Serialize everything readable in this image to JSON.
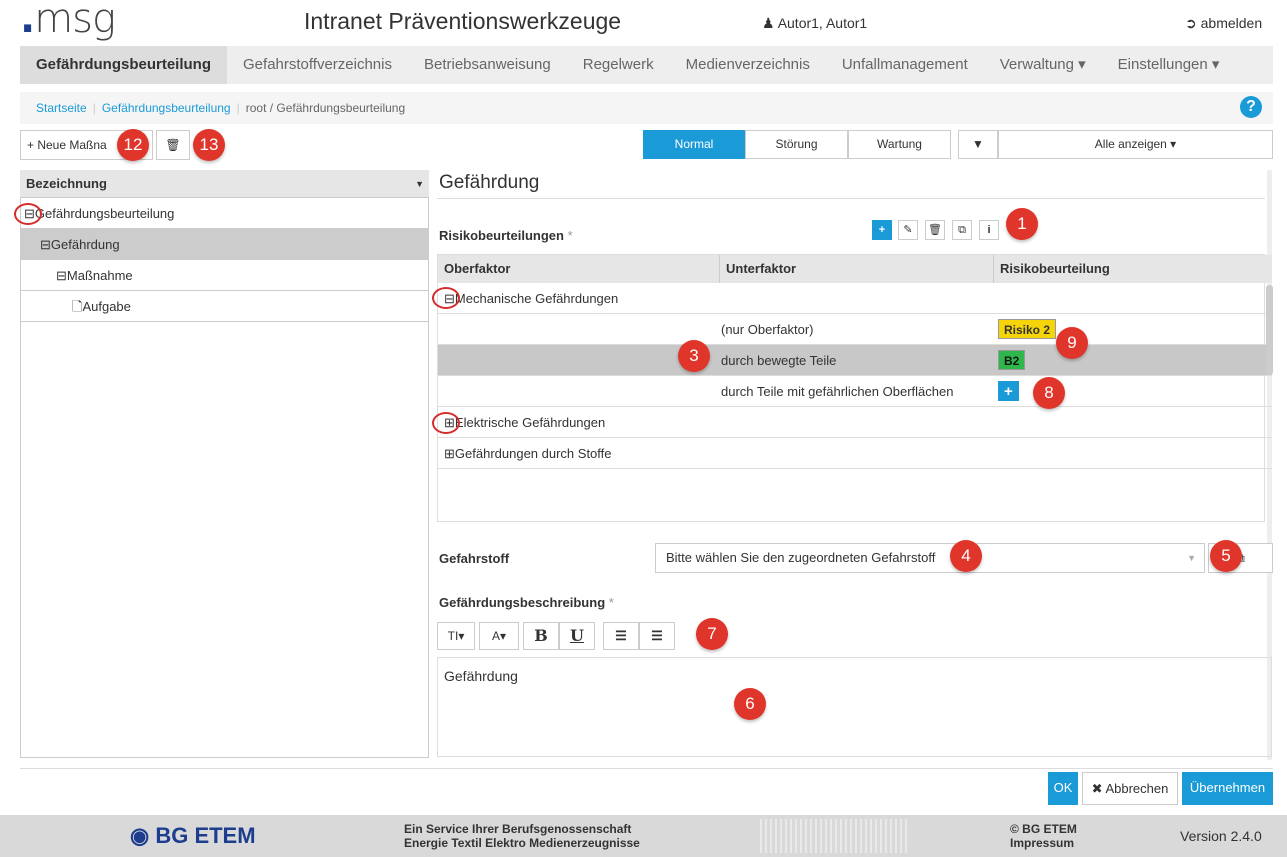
{
  "header": {
    "logo": ".msg",
    "title": "Intranet Präventionswerkzeuge",
    "user": "Autor1, Autor1",
    "logout": "abmelden"
  },
  "nav": {
    "items": [
      "Gefährdungsbeurteilung",
      "Gefahrstoffverzeichnis",
      "Betriebsanweisung",
      "Regelwerk",
      "Medienverzeichnis",
      "Unfallmanagement",
      "Verwaltung ▾",
      "Einstellungen ▾"
    ],
    "active": 0
  },
  "breadcrumb": {
    "home": "Startseite",
    "section": "Gefährdungsbeurteilung",
    "current": "root / Gefährdungsbeurteilung"
  },
  "toolbar": {
    "new_label": "+ Neue Maßna",
    "modes": [
      "Normal",
      "Störung",
      "Wartung"
    ],
    "filter_label": "Alle anzeigen ▾"
  },
  "tree": {
    "header": "Bezeichnung",
    "rows": [
      {
        "label": "Gefährdungsbeurteilung",
        "icon": "⊟"
      },
      {
        "label": "Gefährdung",
        "icon": "⊟"
      },
      {
        "label": "Maßnahme",
        "icon": "⊟"
      },
      {
        "label": "Aufgabe",
        "icon": "🗋"
      }
    ]
  },
  "main": {
    "title": "Gefährdung",
    "risk_label": "Risikobeurteilungen",
    "required": "*",
    "columns": [
      "Oberfaktor",
      "Unterfaktor",
      "Risikobeurteilung"
    ],
    "groups": [
      {
        "label": "Mechanische Gefährdungen",
        "icon": "⊟"
      },
      {
        "label": "Elektrische Gefährdungen",
        "icon": "⊞"
      },
      {
        "label": "Gefährdungen durch Stoffe",
        "icon": "⊞"
      }
    ],
    "subrows": [
      {
        "unterfaktor": "(nur Oberfaktor)",
        "risk": "Risiko 2"
      },
      {
        "unterfaktor": "durch bewegte Teile",
        "risk": "B2"
      },
      {
        "unterfaktor": "durch Teile mit gefährlichen Oberflächen",
        "risk": "+"
      }
    ],
    "gefahrstoff_label": "Gefahrstoff",
    "gefahrstoff_placeholder": "Bitte wählen Sie den zugeordneten Gefahrstoff",
    "beschreibung_label": "Gefährdungsbeschreibung",
    "beschreibung_text": "Gefährdung"
  },
  "rte": {
    "font_size": "TI▾",
    "font_color": "A▾",
    "bold": "B",
    "underline": "U"
  },
  "badges": [
    "1",
    "3",
    "4",
    "5",
    "6",
    "7",
    "8",
    "9",
    "12",
    "13"
  ],
  "actions": {
    "ok": "OK",
    "cancel": "✖ Abbrechen",
    "apply": "Übernehmen"
  },
  "footer": {
    "brand": "BG ETEM",
    "service_line1": "Ein Service Ihrer Berufsgenossenschaft",
    "service_line2": "Energie Textil Elektro Medienerzeugnisse",
    "copyright": "© BG ETEM",
    "impressum": "Impressum",
    "version": "Version 2.4.0"
  },
  "colors": {
    "accent": "#1a9bd7",
    "risk_yellow": "#f5d50a",
    "risk_green": "#2eb84b",
    "badge_red": "#e0352b"
  }
}
